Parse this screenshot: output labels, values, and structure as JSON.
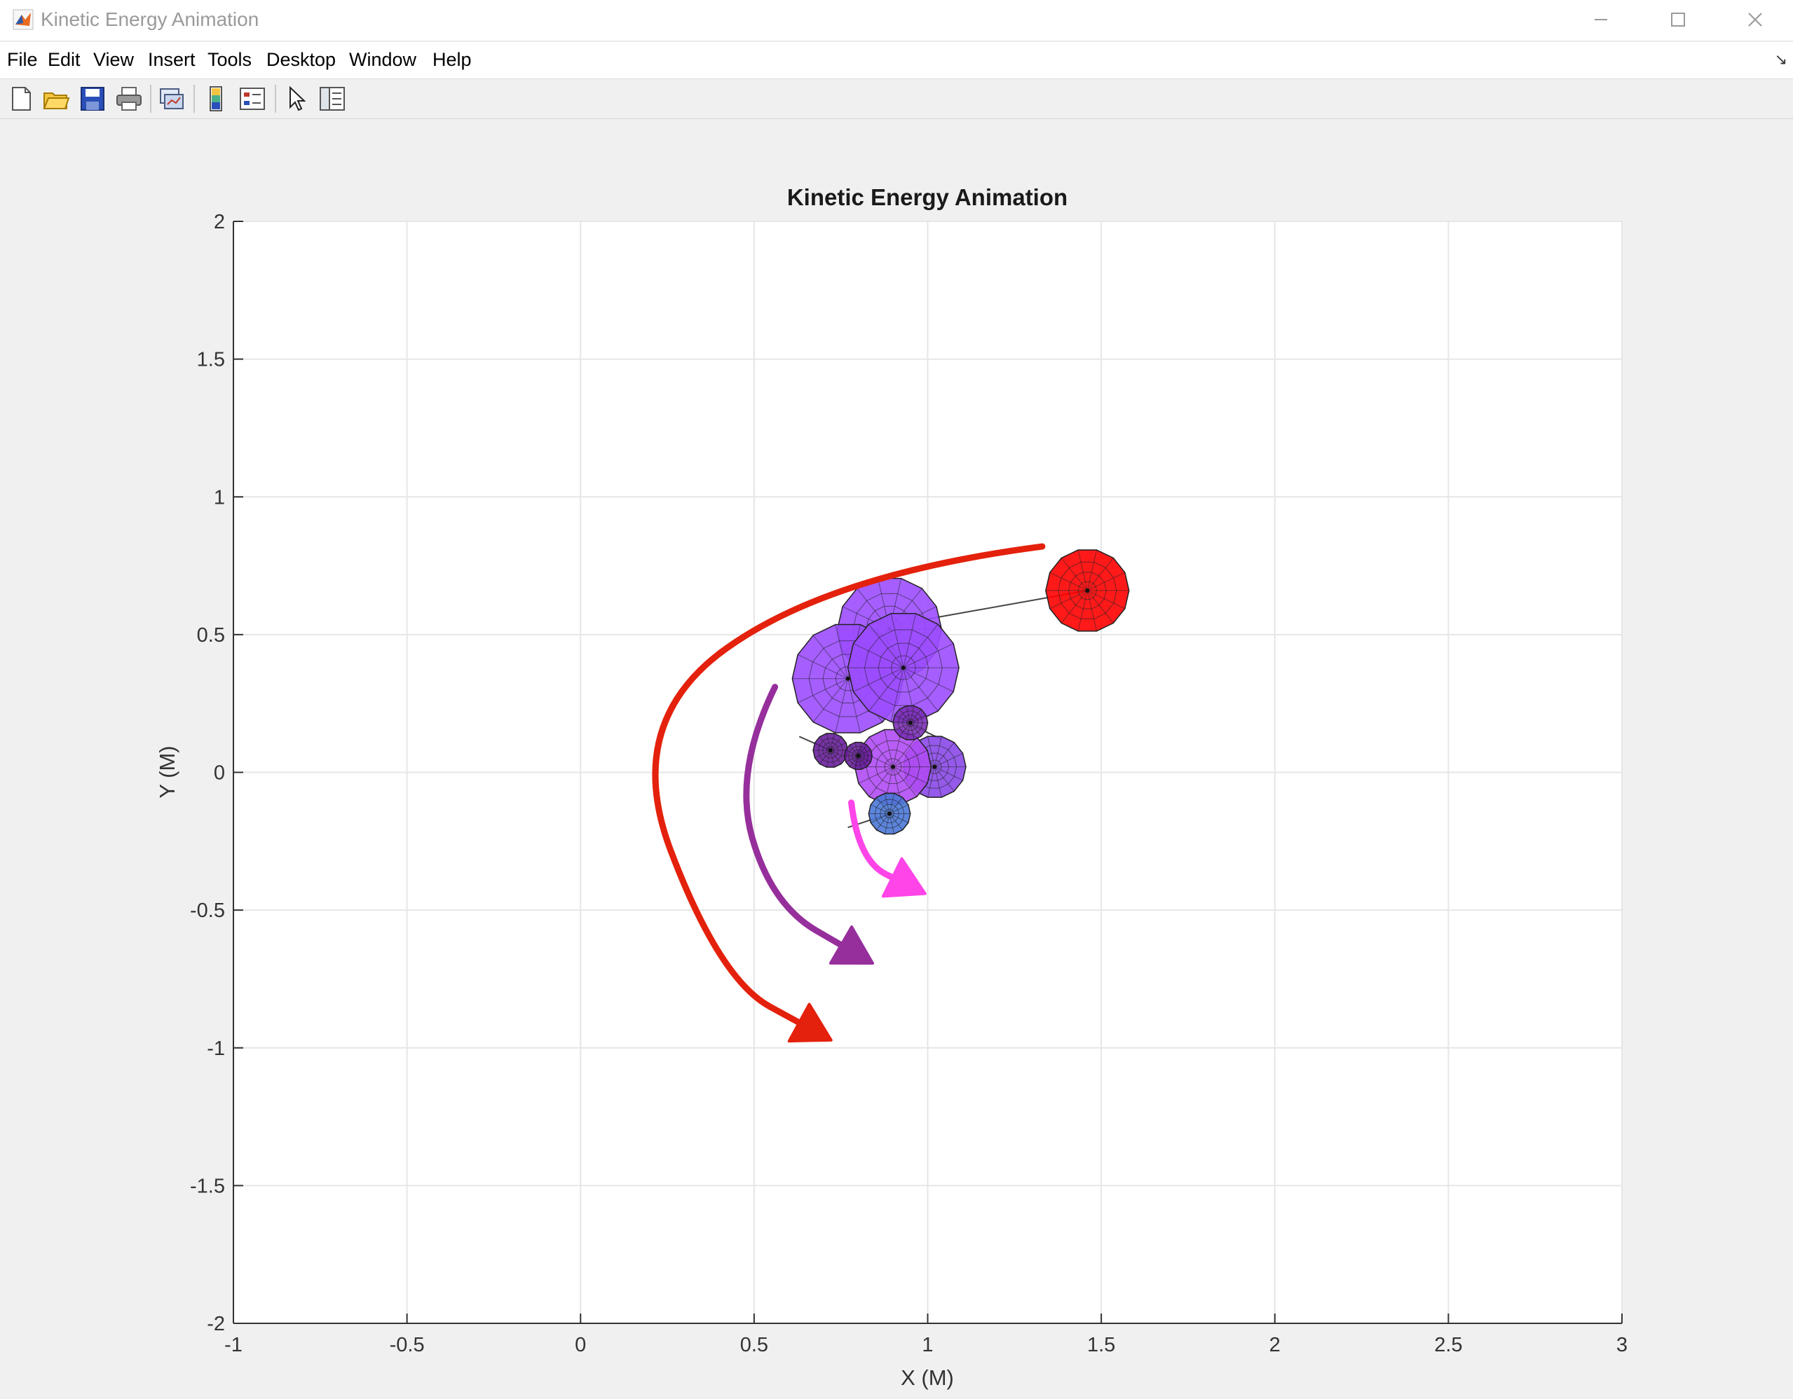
{
  "window": {
    "title": "Kinetic Energy Animation",
    "minimize_icon": "minimize-icon",
    "maximize_icon": "maximize-icon",
    "close_icon": "close-icon"
  },
  "menu": {
    "items": [
      "File",
      "Edit",
      "View",
      "Insert",
      "Tools",
      "Desktop",
      "Window",
      "Help"
    ]
  },
  "toolbar": {
    "icons": [
      "new-figure-icon",
      "open-file-icon",
      "save-icon",
      "print-icon",
      "link-plot-icon",
      "insert-colorbar-icon",
      "insert-legend-icon",
      "edit-plot-icon",
      "property-inspector-icon"
    ]
  },
  "chart_data": {
    "type": "scatter",
    "title": "Kinetic Energy Animation",
    "xlabel": "X (M)",
    "ylabel": "Y (M)",
    "xlim": [
      -1,
      3
    ],
    "ylim": [
      -2,
      2
    ],
    "xticks": [
      "-1",
      "-0.5",
      "0",
      "0.5",
      "1",
      "1.5",
      "2",
      "2.5",
      "3"
    ],
    "yticks": [
      "2",
      "1.5",
      "1",
      "0.5",
      "0",
      "-0.5",
      "-1",
      "-1.5",
      "-2"
    ],
    "grid": true,
    "bodies": [
      {
        "name": "red-body",
        "x": 1.46,
        "y": 0.66,
        "r": 0.12,
        "color": "#ff0000"
      },
      {
        "name": "purple-large-1",
        "x": 0.89,
        "y": 0.52,
        "r": 0.15,
        "color": "#9c4dff"
      },
      {
        "name": "purple-large-2",
        "x": 0.77,
        "y": 0.34,
        "r": 0.16,
        "color": "#9c4dff"
      },
      {
        "name": "purple-large-3",
        "x": 0.93,
        "y": 0.38,
        "r": 0.16,
        "color": "#9c4dff"
      },
      {
        "name": "purple-mid-1",
        "x": 1.02,
        "y": 0.02,
        "r": 0.09,
        "color": "#8a48e8"
      },
      {
        "name": "purple-mid-2",
        "x": 0.9,
        "y": 0.02,
        "r": 0.11,
        "color": "#b04bf5"
      },
      {
        "name": "purple-small-1",
        "x": 0.95,
        "y": 0.18,
        "r": 0.05,
        "color": "#7c2fb8"
      },
      {
        "name": "purple-small-2",
        "x": 0.72,
        "y": 0.08,
        "r": 0.05,
        "color": "#6a1e9e"
      },
      {
        "name": "purple-small-3",
        "x": 0.8,
        "y": 0.06,
        "r": 0.04,
        "color": "#6a1e9e"
      },
      {
        "name": "blue-small",
        "x": 0.89,
        "y": -0.15,
        "r": 0.06,
        "color": "#4a78d8"
      }
    ],
    "links": [
      {
        "from": [
          1.46,
          0.66
        ],
        "to": [
          0.97,
          0.55
        ]
      },
      {
        "from": [
          0.94,
          0.18
        ],
        "to": [
          1.04,
          0.12
        ]
      },
      {
        "from": [
          0.63,
          0.13
        ],
        "to": [
          0.72,
          0.08
        ]
      },
      {
        "from": [
          0.77,
          -0.2
        ],
        "to": [
          0.89,
          -0.15
        ]
      }
    ],
    "arrows": [
      {
        "name": "red-arrow",
        "color": "#e4210c",
        "path": [
          [
            1.33,
            0.82
          ],
          [
            0.72,
            0.72
          ],
          [
            0.12,
            0.18
          ],
          [
            0.4,
            -0.75
          ],
          [
            0.69,
            -0.95
          ]
        ]
      },
      {
        "name": "purple-arrow",
        "color": "#962f9c",
        "path": [
          [
            0.56,
            0.31
          ],
          [
            0.44,
            0.0
          ],
          [
            0.55,
            -0.48
          ],
          [
            0.81,
            -0.67
          ]
        ]
      },
      {
        "name": "pink-arrow",
        "color": "#ff44e8",
        "path": [
          [
            0.78,
            -0.11
          ],
          [
            0.8,
            -0.32
          ],
          [
            0.96,
            -0.42
          ]
        ]
      }
    ]
  }
}
